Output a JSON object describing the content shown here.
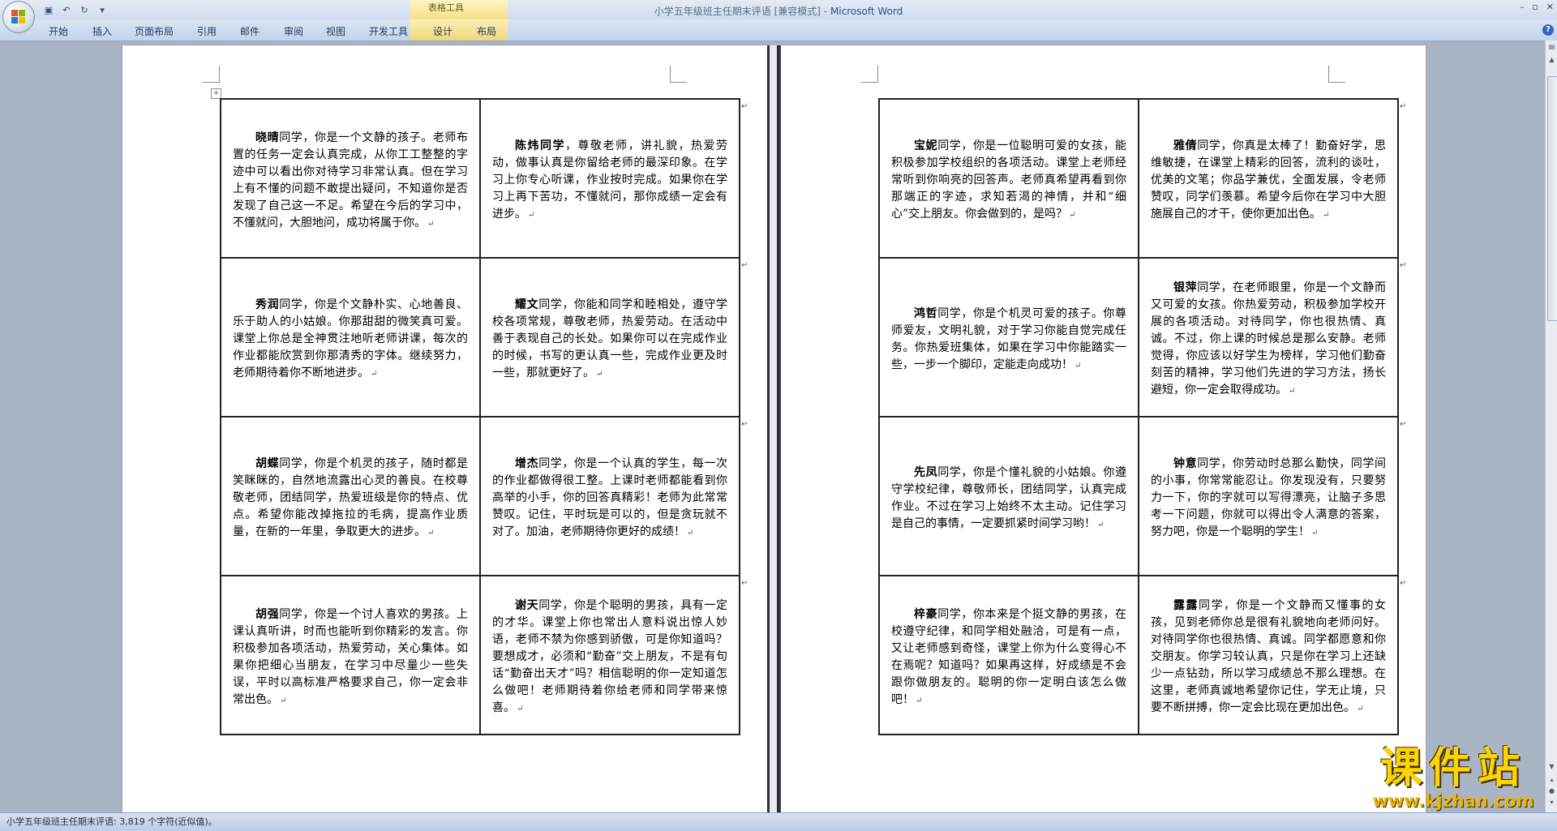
{
  "window": {
    "title": "小学五年级班主任期末评语 [兼容模式]",
    "app_name": "Microsoft Word",
    "title_separator": " - "
  },
  "ribbon": {
    "contextual_group": "表格工具",
    "tabs": [
      "开始",
      "插入",
      "页面布局",
      "引用",
      "邮件",
      "审阅",
      "视图",
      "开发工具",
      "设计",
      "布局"
    ]
  },
  "pages": [
    {
      "cells": [
        {
          "name": "晓晴",
          "text": "同学，你是一个文静的孩子。老师布置的任务一定会认真完成，从你工工整整的字迹中可以看出你对待学习非常认真。但在学习上有不懂的问题不敢提出疑问，不知道你是否发现了自己这一不足。希望在今后的学习中，不懂就问，大胆地问，成功将属于你。"
        },
        {
          "name": "陈炜同学",
          "text": "，尊敬老师，讲礼貌，热爱劳动，做事认真是你留给老师的最深印象。在学习上你专心听课，作业按时完成。如果你在学习上再下苦功，不懂就问，那你成绩一定会有进步。"
        },
        {
          "name": "秀润",
          "text": "同学，你是个文静朴实、心地善良、乐于助人的小姑娘。你那甜甜的微笑真可爱。课堂上你总是全神贯注地听老师讲课，每次的作业都能欣赏到你那清秀的字体。继续努力，老师期待着你不断地进步。"
        },
        {
          "name": "耀文",
          "text": "同学，你能和同学和睦相处，遵守学校各项常规，尊敬老师，热爱劳动。在活动中善于表现自己的长处。如果你可以在完成作业的时候，书写的更认真一些，完成作业更及时一些，那就更好了。"
        },
        {
          "name": "胡蝶",
          "text": "同学，你是个机灵的孩子，随时都是笑眯眯的，自然地流露出心灵的善良。在校尊敬老师，团结同学，热爱班级是你的特点、优点。希望你能改掉拖拉的毛病，提高作业质量，在新的一年里，争取更大的进步。"
        },
        {
          "name": "增杰",
          "text": "同学，你是一个认真的学生，每一次的作业都做得很工整。上课时老师都能看到你高举的小手，你的回答真精彩！老师为此常常赞叹。记住，平时玩是可以的，但是贪玩就不对了。加油，老师期待你更好的成绩！"
        },
        {
          "name": "胡强",
          "text": "同学，你是一个讨人喜欢的男孩。上课认真听讲，时而也能听到你精彩的发言。你积极参加各项活动，热爱劳动，关心集体。如果你把细心当朋友，在学习中尽量少一些失误，平时以高标准严格要求自己，你一定会非常出色。"
        },
        {
          "name": "谢天",
          "text": "同学，你是个聪明的男孩，具有一定的才华。课堂上你也常出人意料说出惊人妙语，老师不禁为你感到骄傲，可是你知道吗？要想成才，必须和“勤奋”交上朋友，不是有句话“勤奋出天才”吗？相信聪明的你一定知道怎么做吧！老师期待着你给老师和同学带来惊喜。"
        }
      ]
    },
    {
      "cells": [
        {
          "name": "宝妮",
          "text": "同学，你是一位聪明可爱的女孩，能积极参加学校组织的各项活动。课堂上老师经常听到你响亮的回答声。老师真希望再看到你那端正的字迹，求知若渴的神情，并和“细心”交上朋友。你会做到的，是吗？"
        },
        {
          "name": "雅倩",
          "text": "同学，你真是太棒了！勤奋好学，思维敏捷，在课堂上精彩的回答，流利的谈吐，优美的文笔；你品学兼优，全面发展，令老师赞叹，同学们羡慕。希望今后你在学习中大胆施展自己的才干，使你更加出色。"
        },
        {
          "name": "鸿哲",
          "text": "同学，你是个机灵可爱的孩子。你尊师爱友，文明礼貌，对于学习你能自觉完成任务。你热爱班集体，如果在学习中你能踏实一些，一步一个脚印，定能走向成功！"
        },
        {
          "name": "银萍",
          "text": "同学，在老师眼里，你是一个文静而又可爱的女孩。你热爱劳动，积极参加学校开展的各项活动。对待同学，你也很热情、真诚。不过，你上课的时候总是那么安静。老师觉得，你应该以好学生为榜样，学习他们勤奋刻苦的精神，学习他们先进的学习方法，扬长避短，你一定会取得成功。"
        },
        {
          "name": "先凤",
          "text": "同学，你是个懂礼貌的小姑娘。你遵守学校纪律，尊敬师长，团结同学，认真完成作业。不过在学习上始终不太主动。记住学习是自己的事情，一定要抓紧时间学习哟！"
        },
        {
          "name": "钟意",
          "text": "同学，你劳动时总那么勤快，同学间的小事，你常常能忍让。你发现没有，只要努力一下，你的字就可以写得漂亮，让脑子多思考一下问题，你就可以得出令人满意的答案，努力吧，你是一个聪明的学生！"
        },
        {
          "name": "梓豪",
          "text": "同学，你本来是个挺文静的男孩，在校遵守纪律，和同学相处融洽，可是有一点，又让老师感到奇怪，课堂上你为什么变得心不在焉呢？知道吗？如果再这样，好成绩是不会跟你做朋友的。聪明的你一定明白该怎么做吧！"
        },
        {
          "name": "露露",
          "text": "同学，你是一个文静而又懂事的女孩，见到老师你总是很有礼貌地向老师问好。对待同学你也很热情、真诚。同学都愿意和你交朋友。你学习较认真，只是你在学习上还缺少一点钻劲，所以学习成绩总不那么理想。在这里，老师真诚地希望你记住，学无止境，只要不断拼搏，你一定会比现在更加出色。"
        }
      ]
    }
  ],
  "status_bar": {
    "text": "小学五年级班主任期末评语: 3,819 个字符(近似值)。"
  },
  "watermark": {
    "line1": "课件站",
    "line2": "www.kjzhan.com"
  }
}
